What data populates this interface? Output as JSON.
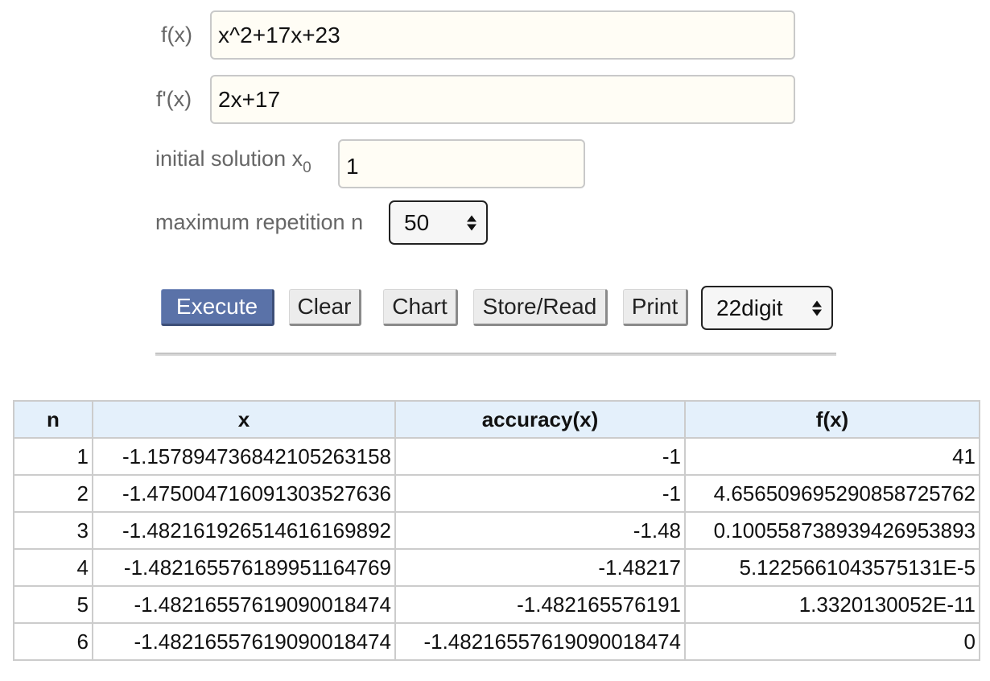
{
  "form": {
    "fx_label": "f(x)",
    "fx_value": "x^2+17x+23",
    "dfx_label": "f'(x)",
    "dfx_value": "2x+17",
    "x0_label": "initial solution x",
    "x0_subscript": "0",
    "x0_value": "1",
    "n_label": "maximum repetition n",
    "n_value": "50"
  },
  "buttons": {
    "execute": "Execute",
    "clear": "Clear",
    "chart": "Chart",
    "store_read": "Store/Read",
    "print": "Print",
    "digits": "22digit"
  },
  "table": {
    "headers": [
      "n",
      "x",
      "accuracy(x)",
      "f(x)"
    ],
    "rows": [
      [
        "1",
        "-1.157894736842105263158",
        "-1",
        "41"
      ],
      [
        "2",
        "-1.475004716091303527636",
        "-1",
        "4.656509695290858725762"
      ],
      [
        "3",
        "-1.482161926514616169892",
        "-1.48",
        "0.100558738939426953893"
      ],
      [
        "4",
        "-1.482165576189951164769",
        "-1.48217",
        "5.1225661043575131E-5"
      ],
      [
        "5",
        "-1.48216557619090018474",
        "-1.482165576191",
        "1.3320130052E-11"
      ],
      [
        "6",
        "-1.48216557619090018474",
        "-1.48216557619090018474",
        "0"
      ]
    ]
  },
  "colors": {
    "primary_button": "#5a72a8",
    "header_bg": "#e4f0fb",
    "input_bg": "#fffdf5"
  }
}
